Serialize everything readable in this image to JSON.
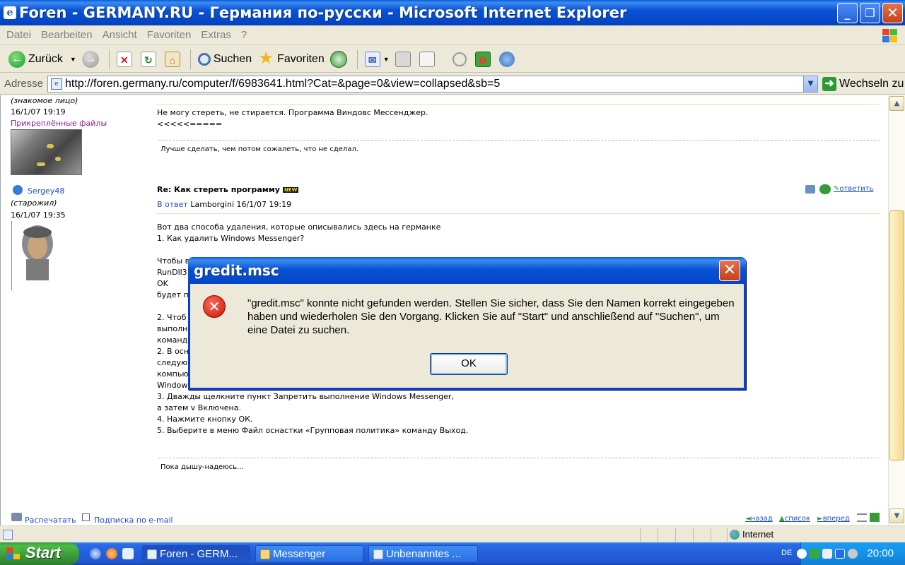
{
  "window": {
    "title": "Foren - GERMANY.RU - Германия по-русски - Microsoft Internet Explorer"
  },
  "menu": [
    "Datei",
    "Bearbeiten",
    "Ansicht",
    "Favoriten",
    "Extras",
    "?"
  ],
  "toolbar": {
    "back": "Zurück",
    "search": "Suchen",
    "favorites": "Favoriten"
  },
  "address": {
    "label": "Adresse",
    "url": "http://foren.germany.ru/computer/f/6983641.html?Cat=&page=0&view=collapsed&sb=5",
    "go": "Wechseln zu"
  },
  "posts": [
    {
      "status": "(знакомое лицо)",
      "date": "16/1/07 19:19",
      "attachments": "Прикреплённые файлы",
      "lines": [
        "Не могу стереть, не стирается. Программа Виндовс Мессенджер.",
        "<<<<<====="
      ],
      "signature": "Лучше сделать, чем потом сожалеть, что не сделал."
    },
    {
      "author": "Sergey48",
      "status": "(старожил)",
      "date": "16/1/07 19:35",
      "subject": "Re: Как стереть программу",
      "new_badge": "NEW",
      "reply_prefix": "В ответ",
      "reply_to": "Lamborgini 16/1/07 19:19",
      "reply_action": "ответить",
      "lines": [
        "Вот два способа удаления, которые описывались здесь на германке",
        "1. Как удалить Windows Messenger?",
        "",
        "Чтобы в",
        "RunDll3",
        "OK",
        "будет п",
        "",
        "2. Чтоб",
        "выполн",
        "команд",
        "2. В осн",
        "следую",
        "компью",
        "Window",
        "3. Дважды щелкните пункт Запретить выполнение Windows Messenger,",
        "а затем v Включена.",
        "4. Нажмите кнопку ОК.",
        "5. Выберите в меню Файл оснастки «Групповая политика» команду Выход."
      ],
      "signature": "Пока дышу-надеюсь..."
    }
  ],
  "footer": {
    "print": "Распечатать",
    "subscribe": "Подписка по e-mail",
    "back": "назад",
    "list": "список",
    "forward": "вперед"
  },
  "dialog": {
    "title": "gredit.msc",
    "message": "\"gredit.msc\" konnte nicht gefunden werden. Stellen Sie sicher, dass Sie den Namen korrekt eingegeben haben und wiederholen Sie den Vorgang. Klicken Sie auf \"Start\" und anschließend auf \"Suchen\", um eine Datei zu suchen.",
    "ok": "OK"
  },
  "statusbar": {
    "zone": "Internet"
  },
  "taskbar": {
    "start": "Start",
    "tasks": [
      "Foren - GERM...",
      "Messenger",
      "Unbenanntes ..."
    ],
    "language": "DE",
    "clock": "20:00"
  },
  "colors": {
    "titlebar": "#0a53d2",
    "start_button": "#3a9a37",
    "link": "#1a4dc4",
    "attachment_link": "#8a1c9a",
    "error": "#c8140a"
  }
}
